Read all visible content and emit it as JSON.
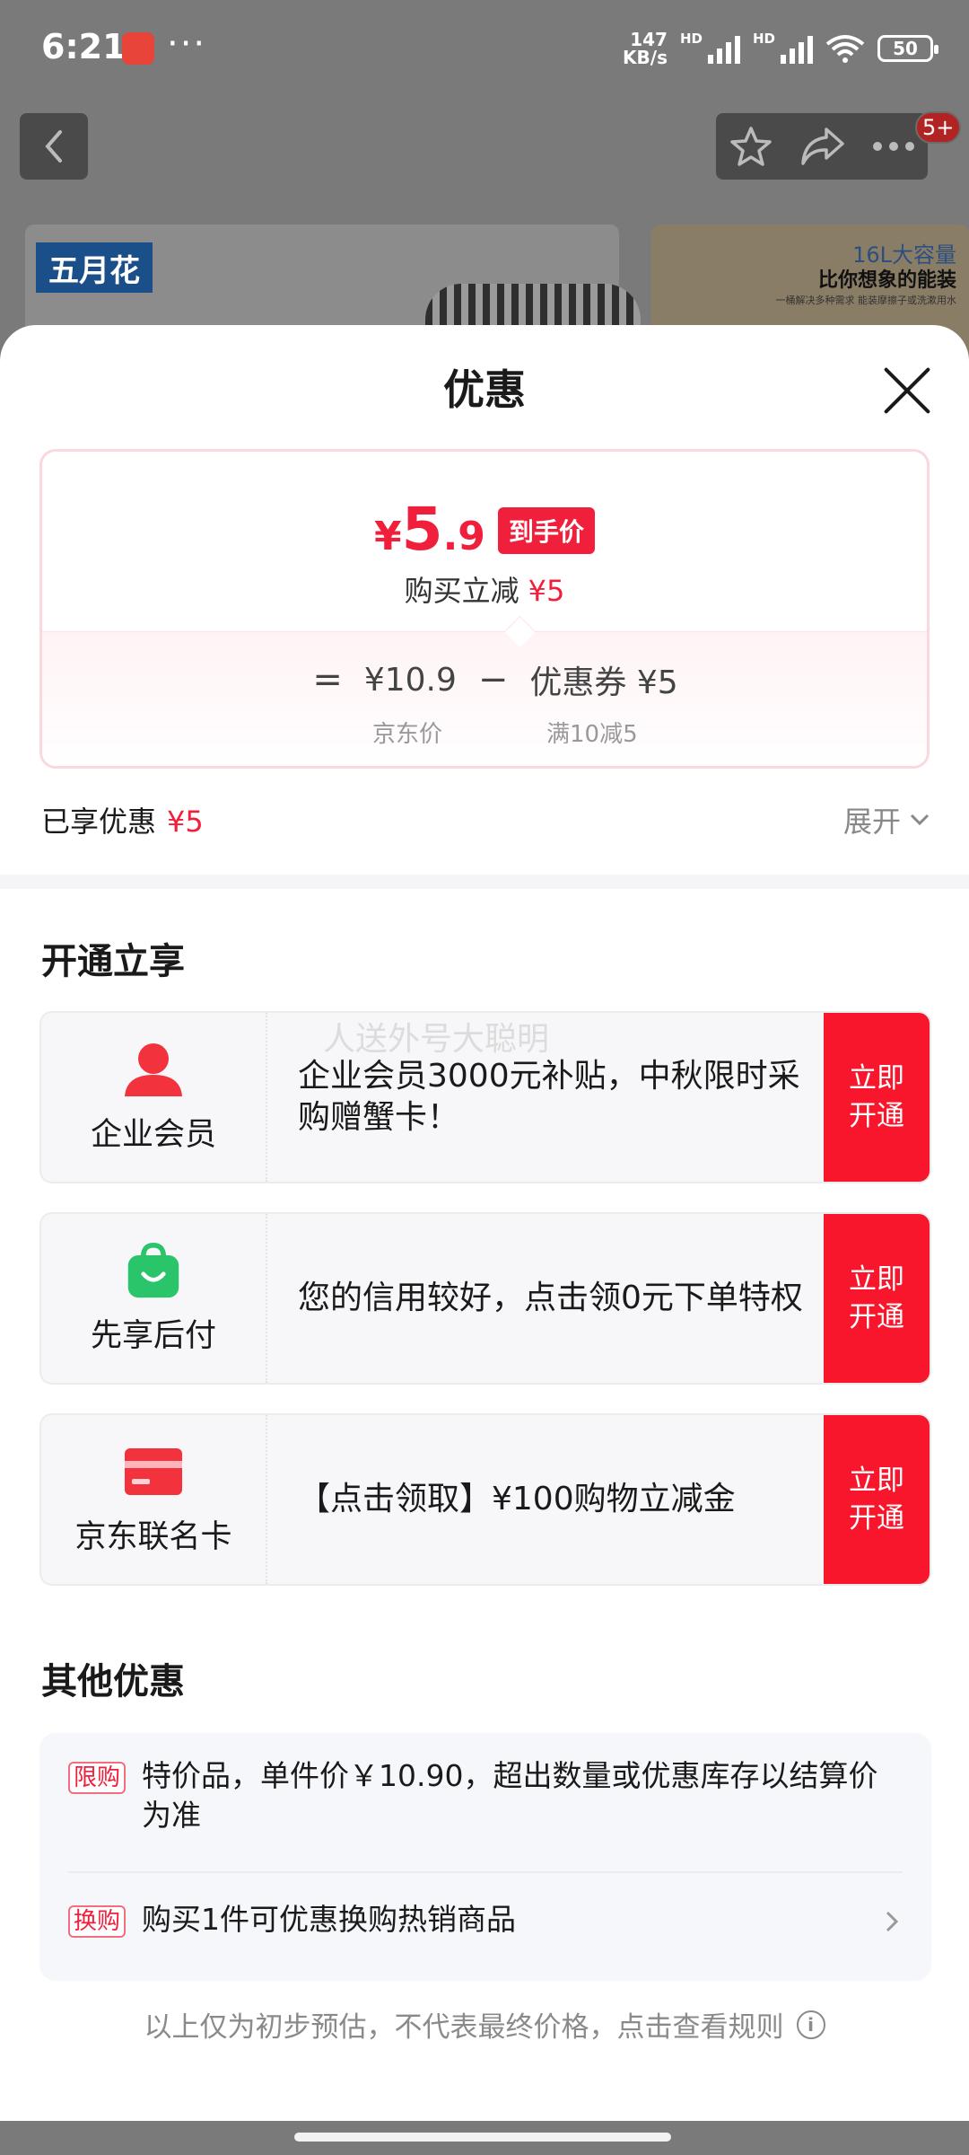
{
  "status_bar": {
    "time": "6:21",
    "dots": "···",
    "net_speed_value": "147",
    "net_speed_unit": "KB/s",
    "hd1": "HD",
    "hd2": "HD",
    "wifi_sub": "6",
    "battery": "50"
  },
  "top_bar": {
    "badge": "5+"
  },
  "background": {
    "brand_text": "五月花",
    "banner_line1": "16L大容量",
    "banner_line2": "比你想象的能装",
    "banner_line3": "一桶解决多种需求 能装摩擦子或洗漱用水"
  },
  "sheet": {
    "title": "优惠",
    "price": {
      "currency": "¥",
      "integer": "5",
      "decimal": ".9",
      "tag": "到手价",
      "instant_label": "购买立减",
      "instant_value": "¥5",
      "equals": "=",
      "jd_price": "¥10.9",
      "minus": "−",
      "coupon": "优惠券 ¥5",
      "jd_price_label": "京东价",
      "coupon_rule": "满10减5"
    },
    "enjoyed_label": "已享优惠",
    "enjoyed_value": "¥5",
    "expand_label": "展开",
    "section_open": "开通立享",
    "watermark": "人送外号大聪明",
    "members": [
      {
        "name": "企业会员",
        "desc": "企业会员3000元补贴，中秋限时采购赠蟹卡！",
        "button": "立即开通",
        "icon": "person-icon",
        "color": "#f2323c"
      },
      {
        "name": "先享后付",
        "desc": "您的信用较好，点击领0元下单特权",
        "button": "立即开通",
        "icon": "shopping-bag-icon",
        "color": "#2ac46a"
      },
      {
        "name": "京东联名卡",
        "desc": "【点击领取】¥100购物立减金",
        "button": "立即开通",
        "icon": "credit-card-icon",
        "color": "#f2323c"
      }
    ],
    "section_other": "其他优惠",
    "other": [
      {
        "tag": "限购",
        "text": "特价品，单件价￥10.90，超出数量或优惠库存以结算价为准"
      },
      {
        "tag": "换购",
        "text": "购买1件可优惠换购热销商品"
      }
    ],
    "disclaimer": "以上仅为初步预估，不代表最终价格，点击查看规则"
  }
}
